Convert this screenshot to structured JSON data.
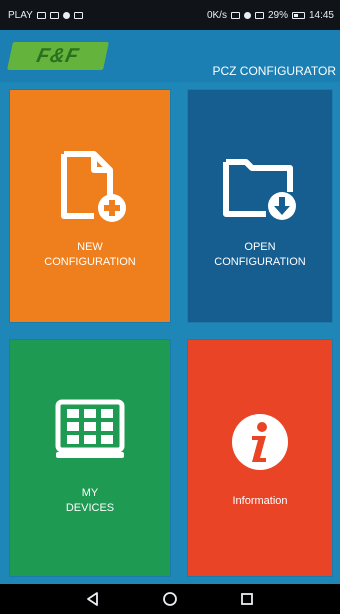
{
  "status_bar": {
    "carrier": "PLAY",
    "data_speed": "0K/s",
    "battery_percent": "29%",
    "time": "14:45"
  },
  "header": {
    "logo_text": "F&F",
    "title": "PCZ CONFIGURATOR"
  },
  "tiles": [
    {
      "id": "new-configuration",
      "line1": "NEW",
      "line2": "CONFIGURATION",
      "icon": "new-file-icon",
      "color": "#ef7f1c"
    },
    {
      "id": "open-configuration",
      "line1": "OPEN",
      "line2": "CONFIGURATION",
      "icon": "open-folder-icon",
      "color": "#165d90"
    },
    {
      "id": "my-devices",
      "line1": "MY",
      "line2": "DEVICES",
      "icon": "device-grid-icon",
      "color": "#1e9a52"
    },
    {
      "id": "information",
      "line1": "Information",
      "icon": "info-icon",
      "color": "#ea4427"
    }
  ],
  "nav_bar": {
    "buttons": [
      "back-icon",
      "home-icon",
      "recents-icon"
    ]
  }
}
